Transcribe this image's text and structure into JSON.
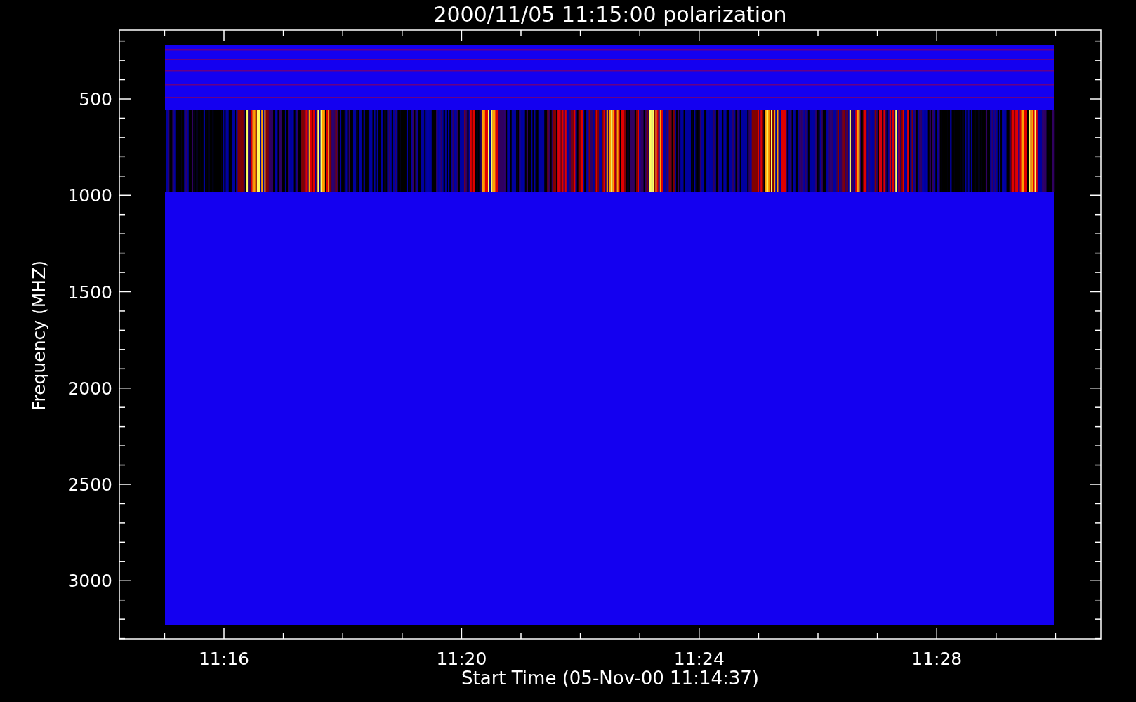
{
  "title": "2000/11/05 11:15:00 polarization",
  "xlabel": "Start Time (05-Nov-00 11:14:37)",
  "ylabel": "Frequency (MHZ)",
  "xticks": [
    "11:16",
    "11:20",
    "11:24",
    "11:28"
  ],
  "yticks": [
    "500",
    "1000",
    "1500",
    "2000",
    "2500",
    "3000"
  ]
}
